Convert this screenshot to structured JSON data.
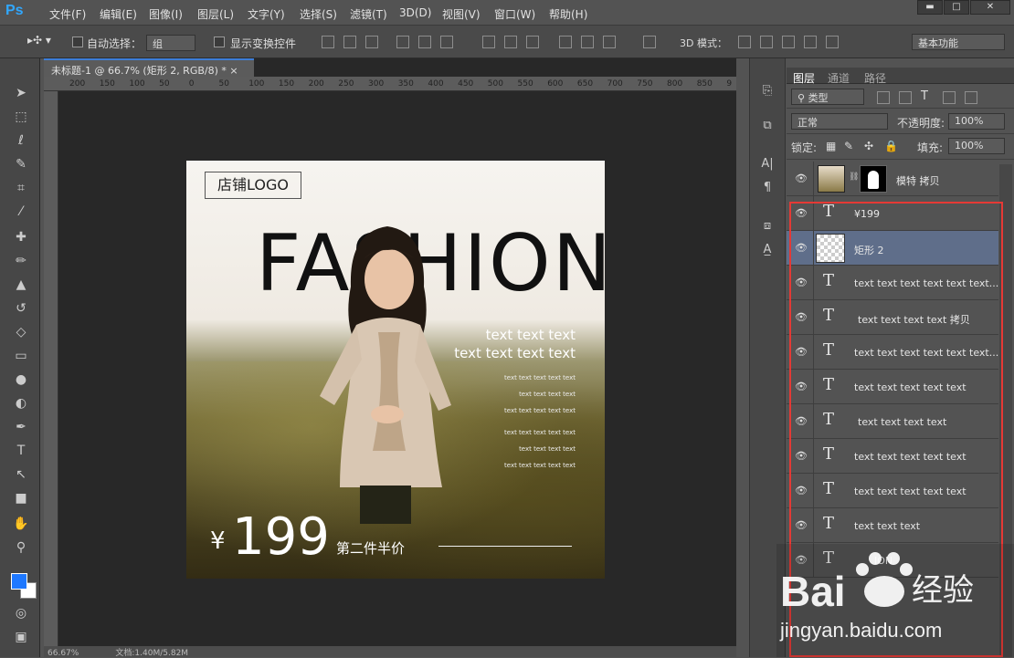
{
  "app": {
    "logo": "Ps"
  },
  "menubar": {
    "items": [
      "文件(F)",
      "编辑(E)",
      "图像(I)",
      "图层(L)",
      "文字(Y)",
      "选择(S)",
      "滤镜(T)",
      "3D(D)",
      "视图(V)",
      "窗口(W)",
      "帮助(H)"
    ],
    "minimize": "▬",
    "maximize": "□",
    "close": "✕"
  },
  "options": {
    "auto_select_label": "自动选择：",
    "auto_select_value": "组",
    "show_transform_label": "显示变换控件",
    "mode_3d_label": "3D 模式：",
    "workspace": "基本功能"
  },
  "document": {
    "tab_title": "未标题-1 @ 66.7% (矩形 2, RGB/8) *",
    "tab_close": "×",
    "zoom": "66.67%",
    "doc_info": "文档:1.40M/5.82M",
    "ruler_ticks": [
      "200",
      "150",
      "100",
      "50",
      "0",
      "50",
      "100",
      "150",
      "200",
      "250",
      "300",
      "350",
      "400",
      "450",
      "500",
      "550",
      "600",
      "650",
      "700",
      "750",
      "800",
      "850",
      "9"
    ]
  },
  "artwork": {
    "logo_text": "店铺LOGO",
    "fashion": "FASHION",
    "subtitle1": "text text text",
    "subtitle2": "text text text text",
    "small_lines": [
      "text text text text text",
      "text text text text",
      "text text text text text",
      "text text text text text",
      "text text text text",
      "text text text text text"
    ],
    "currency": "¥",
    "price": "199",
    "promo": "第二件半价"
  },
  "layers_panel": {
    "tabs": [
      "图层",
      "通道",
      "路径"
    ],
    "filter_kind": "类型",
    "blend_mode": "正常",
    "opacity_label": "不透明度:",
    "opacity_value": "100%",
    "lock_label": "锁定:",
    "fill_label": "填充:",
    "fill_value": "100%",
    "layers": [
      {
        "name": "模特 拷贝",
        "type": "image"
      },
      {
        "name": "¥199",
        "type": "text"
      },
      {
        "name": "矩形 2",
        "type": "shape",
        "selected": true
      },
      {
        "name": "text text text text text text...",
        "type": "text"
      },
      {
        "name": "text text text text 拷贝",
        "type": "text"
      },
      {
        "name": "text text text text text text...",
        "type": "text"
      },
      {
        "name": "text text text text text",
        "type": "text"
      },
      {
        "name": "text text text text",
        "type": "text"
      },
      {
        "name": "text text text text text",
        "type": "text"
      },
      {
        "name": "text text text text text",
        "type": "text"
      },
      {
        "name": "text text text",
        "type": "text"
      },
      {
        "name": "ION",
        "type": "text"
      }
    ]
  },
  "watermark": {
    "brand": "Bai",
    "brand2": "经验",
    "url": "jingyan.baidu.com"
  },
  "colors": {
    "accent": "#31a8ff",
    "selection_box": "#e53935",
    "selected_layer": "#5f6e8a"
  }
}
